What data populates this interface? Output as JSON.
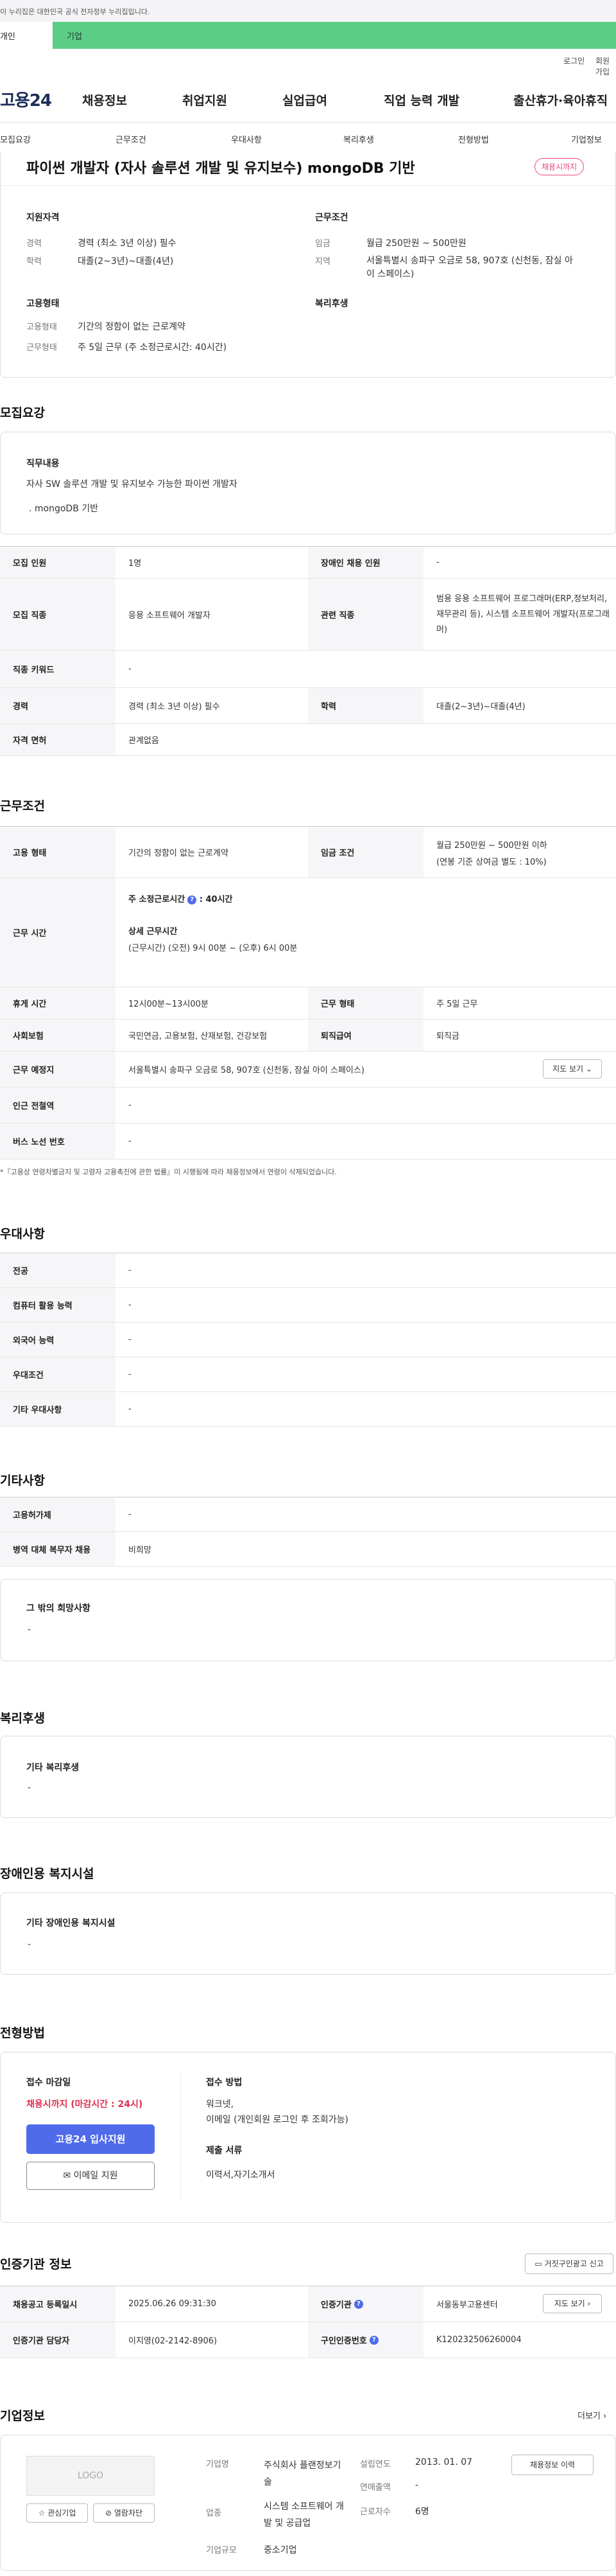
{
  "top_notice": "이 누리집은 대한민국 공식 전자정부 누리집입니다.",
  "tabs": {
    "individual": "개인",
    "company": "기업"
  },
  "util": {
    "login": "로그인",
    "join": "회원가입"
  },
  "logo": "고용24",
  "gnb": [
    "채용정보",
    "취업지원",
    "실업급여",
    "직업 능력 개발",
    "출산휴가·육아휴직"
  ],
  "subnav": [
    "모집요강",
    "근무조건",
    "우대사항",
    "복리후생",
    "전형방법",
    "기업정보"
  ],
  "job": {
    "title": "파이썬 개발자 (자사 솔루션 개발 및 유지보수) mongoDB 기반",
    "badge": "채용시까지",
    "qual_heading": "지원자격",
    "qual": [
      {
        "label": "경력",
        "value": "경력 (최소 3년 이상) 필수"
      },
      {
        "label": "학력",
        "value": "대졸(2~3년)~대졸(4년)"
      }
    ],
    "work_heading": "근무조건",
    "work": [
      {
        "label": "임금",
        "value": "월급 250만원 ~ 500만원"
      },
      {
        "label": "지역",
        "value": "서울특별시 송파구 오금로 58, 907호 (신천동, 잠실 아이 스페이스)"
      }
    ],
    "emp_heading": "고용형태",
    "emp": [
      {
        "label": "고용형태",
        "value": "기간의 정함이 없는 근로계약"
      },
      {
        "label": "근무형태",
        "value": "주 5일 근무 (주 소정근로시간: 40시간)"
      }
    ],
    "welfare_heading": "복리후생"
  },
  "recruit": {
    "heading": "모집요강",
    "duty_title": "직무내용",
    "duty_lines": [
      "자사 SW 솔루션 개발 및 유지보수 가능한 파이썬 개발자",
      ". mongoDB 기반"
    ],
    "rows": [
      {
        "k1": "모집 인원",
        "v1": "1명",
        "k2": "장애인 채용 인원",
        "v2": "-"
      },
      {
        "k1": "모집 직종",
        "v1": "응용 소프트웨어 개발자",
        "k2": "관련 직종",
        "v2": "범용 응용 소프트웨어 프로그래머(ERP,정보처리, 재무관리 등), 시스템 소프트웨어 개발자(프로그래머)"
      },
      {
        "k1": "직종 키워드",
        "v1": "-"
      },
      {
        "k1": "경력",
        "v1": "경력 (최소 3년 이상) 필수",
        "k2": "학력",
        "v2": "대졸(2~3년)~대졸(4년)"
      },
      {
        "k1": "자격 면허",
        "v1": "관계없음"
      }
    ]
  },
  "conditions": {
    "heading": "근무조건",
    "emp_type_k": "고용 형태",
    "emp_type_v": "기간의 정함이 없는 근로계약",
    "wage_k": "임금 조건",
    "wage_v1": "월급 250만원 ~ 500만원 이하",
    "wage_v2": "(연봉 기준 상여금 별도 : 10%)",
    "hours_k": "근무 시간",
    "hours_weekly": "주 소정근로시간",
    "hours_weekly_val": ": 40시간",
    "hours_detail_title": "상세 근무시간",
    "hours_detail": "(근무시간) (오전) 9시 00분 ~ (오후) 6시 00분",
    "break_k": "휴게 시간",
    "break_v": "12시00분~13시00분",
    "form_k": "근무 형태",
    "form_v": "주 5일 근무",
    "ins_k": "사회보험",
    "ins_v": "국민연금, 고용보험, 산재보험, 건강보험",
    "ret_k": "퇴직급여",
    "ret_v": "퇴직금",
    "place_k": "근무 예정지",
    "place_v": "서울특별시 송파구 오금로 58, 907호 (신천동, 잠실 아이 스페이스)",
    "map_btn": "지도 보기",
    "subway_k": "인근 전철역",
    "subway_v": "-",
    "bus_k": "버스 노선 번호",
    "bus_v": "-",
    "note": "*『고용상 연령차별금지 및 고령자 고용촉진에 관한 법률』이 시행됨에 따라 채용정보에서 연령이 삭제되었습니다."
  },
  "pref": {
    "heading": "우대사항",
    "rows": [
      {
        "k": "전공",
        "v": "-"
      },
      {
        "k": "컴퓨터 활용 능력",
        "v": "-"
      },
      {
        "k": "외국어 능력",
        "v": "-"
      },
      {
        "k": "우대조건",
        "v": "-"
      },
      {
        "k": "기타 우대사항",
        "v": "-"
      }
    ]
  },
  "etc": {
    "heading": "기타사항",
    "rows": [
      {
        "k": "고용허가제",
        "v": "-"
      },
      {
        "k": "병역 대체 복무자 채용",
        "v": "비희망"
      }
    ],
    "box_title": "그 밖의 희망사항",
    "box_value": "-"
  },
  "welfare": {
    "heading": "복리후생",
    "box_title": "기타 복리후생",
    "box_value": "-"
  },
  "disabled": {
    "heading": "장애인용 복지시설",
    "box_title": "기타 장애인용 복지시설",
    "box_value": "-"
  },
  "process": {
    "heading": "전형방법",
    "deadline_title": "접수 마감일",
    "deadline_value": "채용시까지 (마감시간 : 24시)",
    "apply_btn": "고용24 입사지원",
    "email_btn": "이메일 지원",
    "method_title": "접수 방법",
    "method_lines": [
      "워크넷,",
      "이메일 (개인회원 로그인 후 조회가능)"
    ],
    "docs_title": "제출 서류",
    "docs_value": "이력서,자기소개서"
  },
  "agency": {
    "heading": "인증기관 정보",
    "report_btn": "거짓구인광고 신고",
    "rows": [
      {
        "k1": "채용공고 등록일시",
        "v1": "2025.06.26 09:31:30",
        "k2": "인증기관",
        "v2": "서울동부고용센터",
        "btn": "지도 보기"
      },
      {
        "k1": "인증기관 담당자",
        "v1": "이지영(02-2142-8906)",
        "k2": "구인인증번호",
        "v2": "K120232506260004"
      }
    ]
  },
  "company": {
    "heading": "기업정보",
    "more": "더보기",
    "logo": "LOGO",
    "fav_btn": "관심기업",
    "block_btn": "열람차단",
    "name_k": "기업명",
    "name_v": "주식회사 플랜정보기술",
    "ind_k": "업종",
    "ind_v": "시스템 소프트웨어 개발 및 공급업",
    "size_k": "기업규모",
    "size_v": "중소기업",
    "est_k": "설립연도",
    "est_v": "2013. 01. 07",
    "sales_k": "연매출액",
    "sales_v": "-",
    "emp_k": "근로자수",
    "emp_v": "6명",
    "history_btn": "채용정보 이력"
  }
}
